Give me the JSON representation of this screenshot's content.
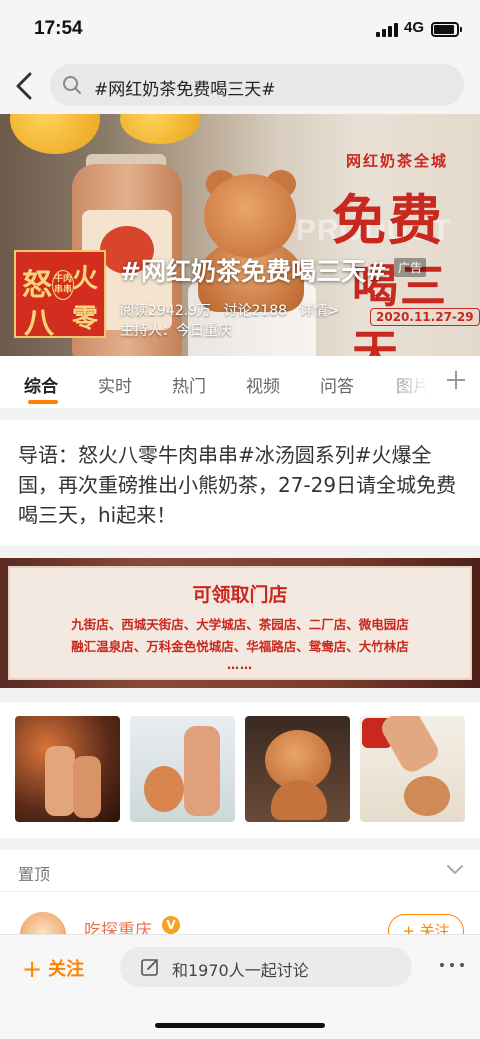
{
  "status_bar": {
    "time": "17:54",
    "network": "4G"
  },
  "search": {
    "query": "#网红奶茶免费喝三天#"
  },
  "banner": {
    "topic_title": "#网红奶茶免费喝三天#",
    "ad_label": "广告",
    "reads": "阅读2942.9万",
    "discussions": "讨论2188",
    "details": "详情>",
    "host": "主持人：今日重庆",
    "promo_subtitle": "网红奶茶全城",
    "promo_big1": "免费",
    "promo_big2": "喝三天",
    "promo_ghost": "PRODUCT",
    "promo_date": "2020.11.27-29",
    "logo_chars": [
      "怒",
      "八",
      "火",
      "零"
    ],
    "logo_badge": "牛肉串串"
  },
  "tabs": [
    "综合",
    "实时",
    "热门",
    "视频",
    "问答",
    "图片"
  ],
  "intro": {
    "text": "导语：怒火八零牛肉串串#冰汤圆系列#火爆全国，再次重磅推出小熊奶茶，27-29日请全城免费喝三天，hi起来！"
  },
  "store_banner": {
    "title": "可领取门店",
    "line1": "九街店、西城天街店、大学城店、茶园店、二厂店、微电园店",
    "line2": "融汇温泉店、万科金色悦城店、华福路店、鸳鸯店、大竹林店",
    "ellipsis": "……"
  },
  "pinned": {
    "label": "置顶"
  },
  "post": {
    "author": "吃探重庆",
    "follow_label": "+ 关注"
  },
  "bottom_bar": {
    "follow_label": "关注",
    "discuss_placeholder": "和1970人一起讨论"
  },
  "colors": {
    "accent": "#ff8200",
    "promo_red": "#c9281f",
    "author_orange": "#eb7350"
  }
}
